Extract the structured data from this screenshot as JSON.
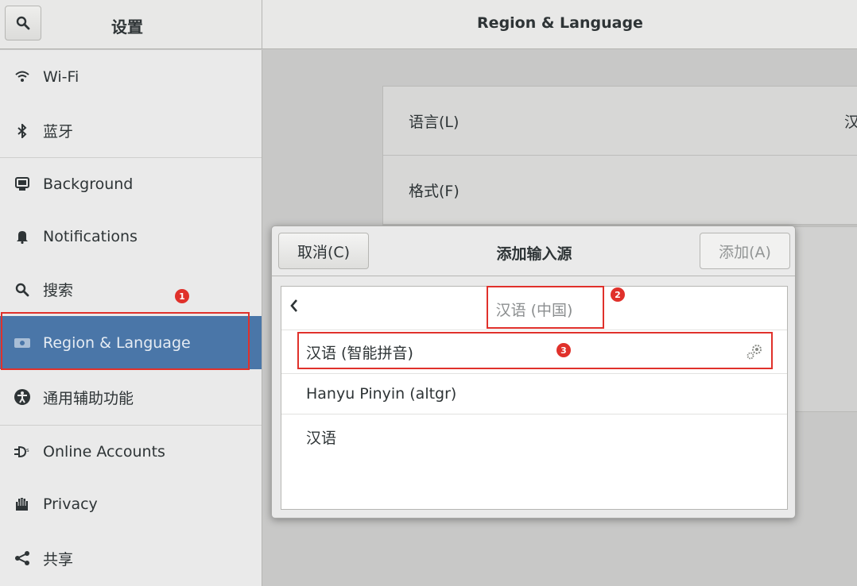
{
  "header": {
    "left_title": "设置",
    "right_title": "Region & Language"
  },
  "sidebar": {
    "items": [
      {
        "label": "Wi-Fi",
        "icon": "wifi-icon"
      },
      {
        "label": "蓝牙",
        "icon": "bluetooth-icon"
      },
      {
        "label": "Background",
        "icon": "background-icon"
      },
      {
        "label": "Notifications",
        "icon": "bell-icon"
      },
      {
        "label": "搜索",
        "icon": "search-icon"
      },
      {
        "label": "Region & Language",
        "icon": "region-icon",
        "selected": true
      },
      {
        "label": "通用辅助功能",
        "icon": "accessibility-icon"
      },
      {
        "label": "Online Accounts",
        "icon": "online-accounts-icon"
      },
      {
        "label": "Privacy",
        "icon": "hand-icon"
      },
      {
        "label": "共享",
        "icon": "share-icon"
      }
    ]
  },
  "content": {
    "rows": [
      {
        "label": "语言(L)",
        "value": "汉"
      },
      {
        "label": "格式(F)",
        "value": ""
      }
    ]
  },
  "dialog": {
    "title": "添加输入源",
    "cancel_label": "取消(C)",
    "add_label": "添加(A)",
    "back_title": "汉语 (中国)",
    "items": [
      {
        "label": "汉语 (智能拼音)",
        "has_settings": true
      },
      {
        "label": "Hanyu Pinyin (altgr)",
        "has_settings": false
      },
      {
        "label": "汉语",
        "has_settings": false
      }
    ]
  },
  "annotations": {
    "badge1": "1",
    "badge2": "2",
    "badge3": "3"
  },
  "colors": {
    "selected": "#4a76a8",
    "annotation": "#e0312b"
  }
}
